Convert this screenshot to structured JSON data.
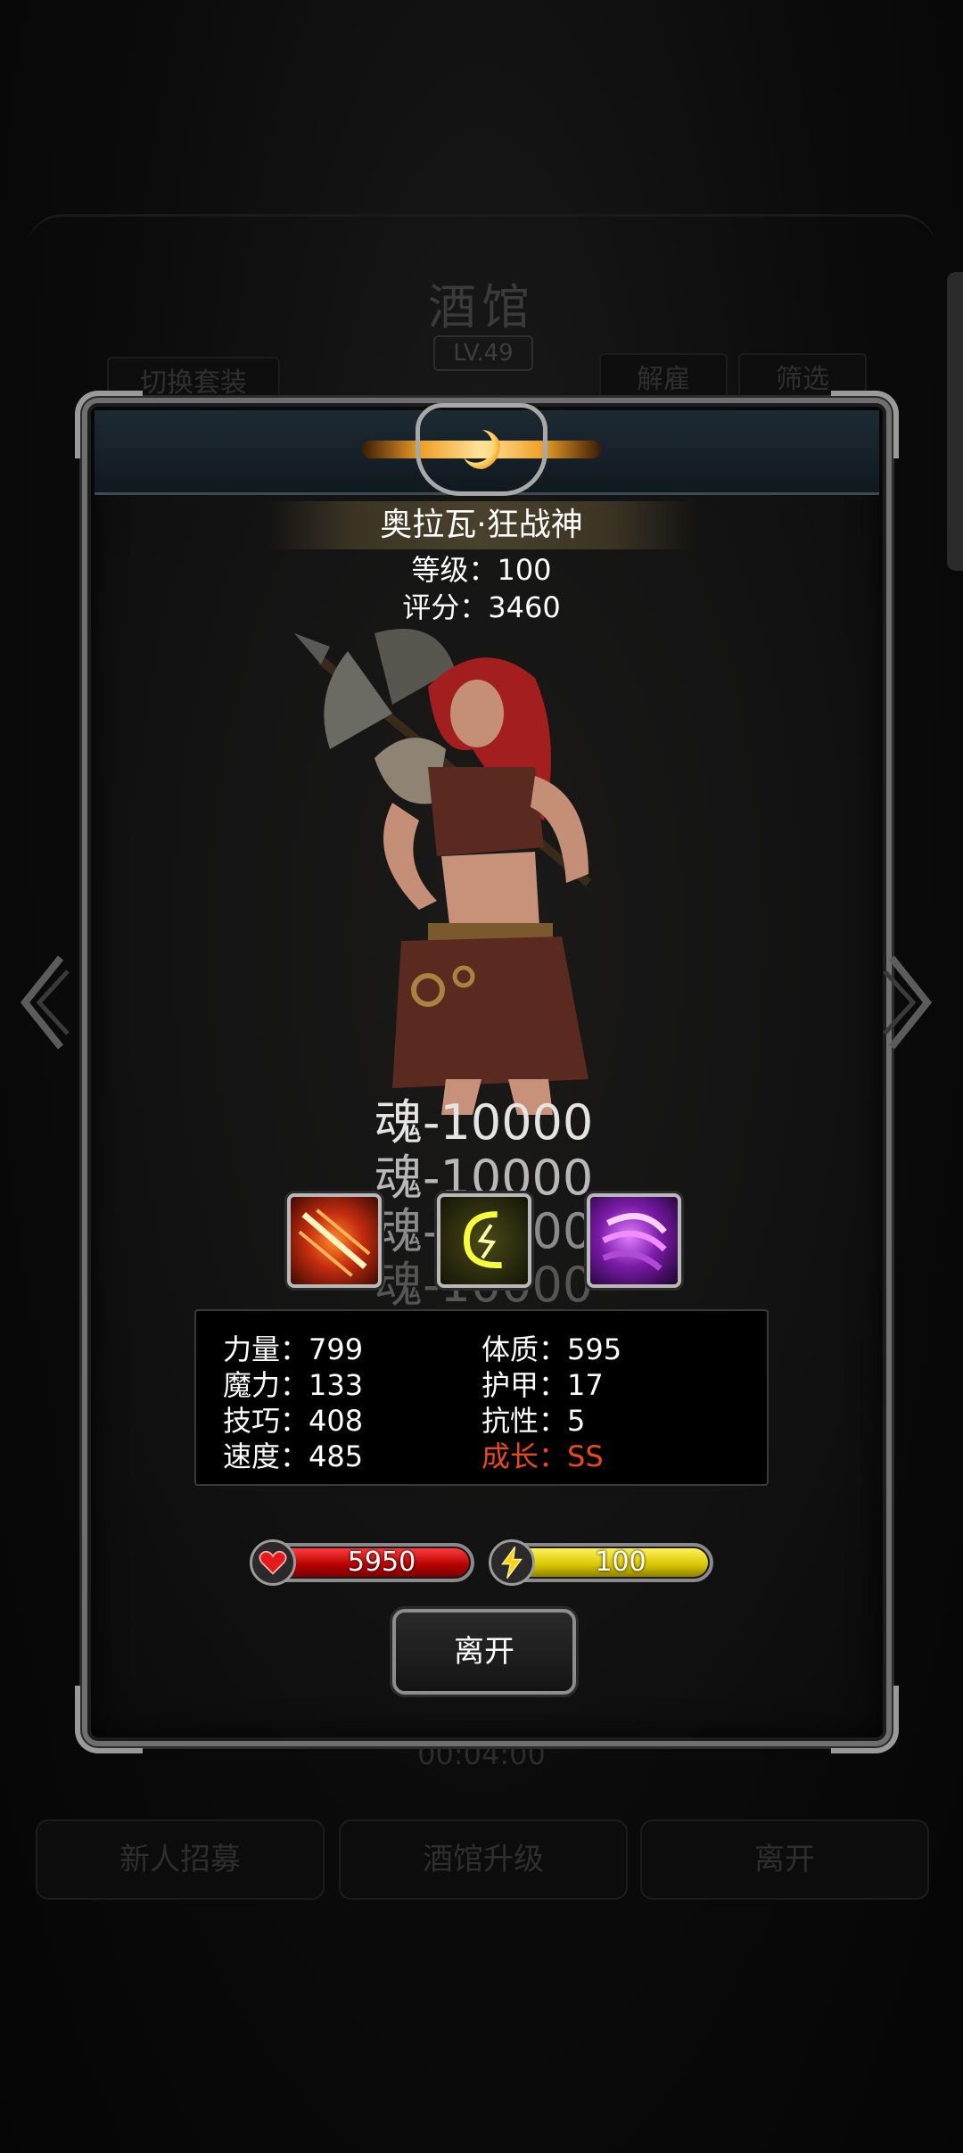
{
  "background": {
    "title": "酒馆",
    "level": "LV.49",
    "switch_outfit": "切换套装",
    "unhire": "解雇",
    "filter": "筛选",
    "timer": "00:04:00",
    "bottom_buttons": [
      "新人招募",
      "酒馆升级",
      "离开"
    ]
  },
  "hero": {
    "name": "奥拉瓦·狂战神",
    "level": "等级：100",
    "score": "评分：3460",
    "soul_lines": [
      "魂-10000",
      "魂-10000",
      "魂-10000",
      "魂-10000"
    ],
    "skills": [
      {
        "icon": "slash-skill-icon"
      },
      {
        "icon": "lightning-skill-icon"
      },
      {
        "icon": "shadow-claw-skill-icon"
      }
    ],
    "stats": {
      "strength": "力量：799",
      "magic": "魔力：133",
      "skill": "技巧：408",
      "speed": "速度：485",
      "constitution": "体质：595",
      "armor": "护甲：17",
      "resistance": "抗性：5",
      "growth": "成长：SS"
    },
    "hp": {
      "value": "5950",
      "fill": 1.0
    },
    "energy": {
      "value": "100",
      "fill": 1.0
    }
  },
  "dialog": {
    "leave": "离开"
  },
  "colors": {
    "growth": "#e34a24",
    "hp_bar": "#d10000",
    "energy_bar": "#e0cc00"
  }
}
